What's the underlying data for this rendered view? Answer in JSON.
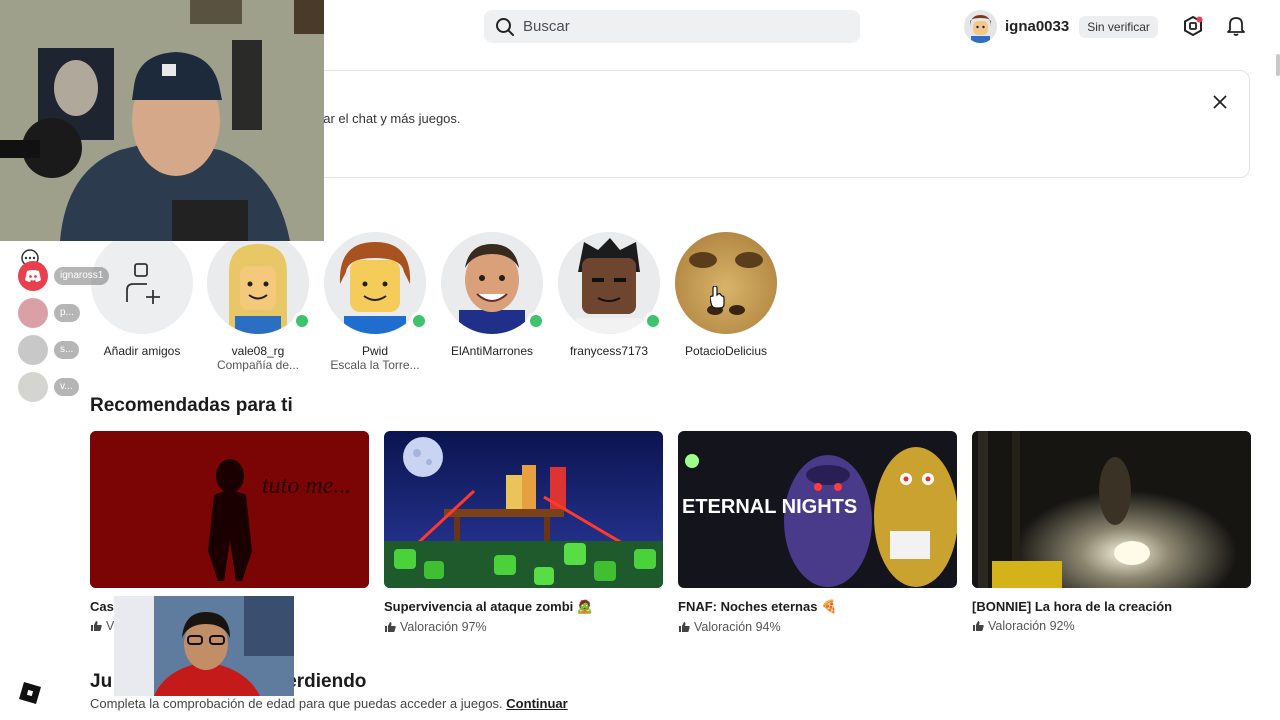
{
  "header": {
    "search_placeholder": "Buscar",
    "username": "igna0033",
    "verify_badge": "Sin verificar"
  },
  "banner": {
    "text": "ear el chat y más juegos."
  },
  "friends": {
    "add_label": "Añadir amigos",
    "items": [
      {
        "name": "vale08_rg",
        "sub": "Compañía de...",
        "online": true
      },
      {
        "name": "Pwid",
        "sub": "Escala la Torre...",
        "online": true
      },
      {
        "name": "ElAntiMarrones",
        "sub": "",
        "online": true
      },
      {
        "name": "franycess7173",
        "sub": "",
        "online": true
      },
      {
        "name": "PotacioDelicius",
        "sub": "",
        "online": false
      }
    ]
  },
  "recommended": {
    "title": "Recomendadas para ti",
    "cards": [
      {
        "title": "Cas",
        "rating": "V",
        "thumb_text": "tuto me..."
      },
      {
        "title": "Supervivencia al ataque zombi 🧟",
        "rating": "Valoración 97%"
      },
      {
        "title": "FNAF: Noches eternas 🍕",
        "rating": "Valoración 94%",
        "thumb_text": "ETERNAL NIGHTS"
      },
      {
        "title": "[BONNIE] La hora de la creación",
        "rating": "Valoración 92%"
      }
    ]
  },
  "missing": {
    "title_left": "Ju",
    "title_right": "erdiendo",
    "subtitle": "Completa la comprobación de edad para que puedas acceder a juegos.",
    "link": "Continuar"
  },
  "discord_overlay": {
    "users": [
      "ignaross1",
      "p...",
      "s...",
      "v..."
    ]
  },
  "colors": {
    "online": "#3cc36b",
    "search_bg": "#eef0f2",
    "discord": "#e8414d"
  }
}
